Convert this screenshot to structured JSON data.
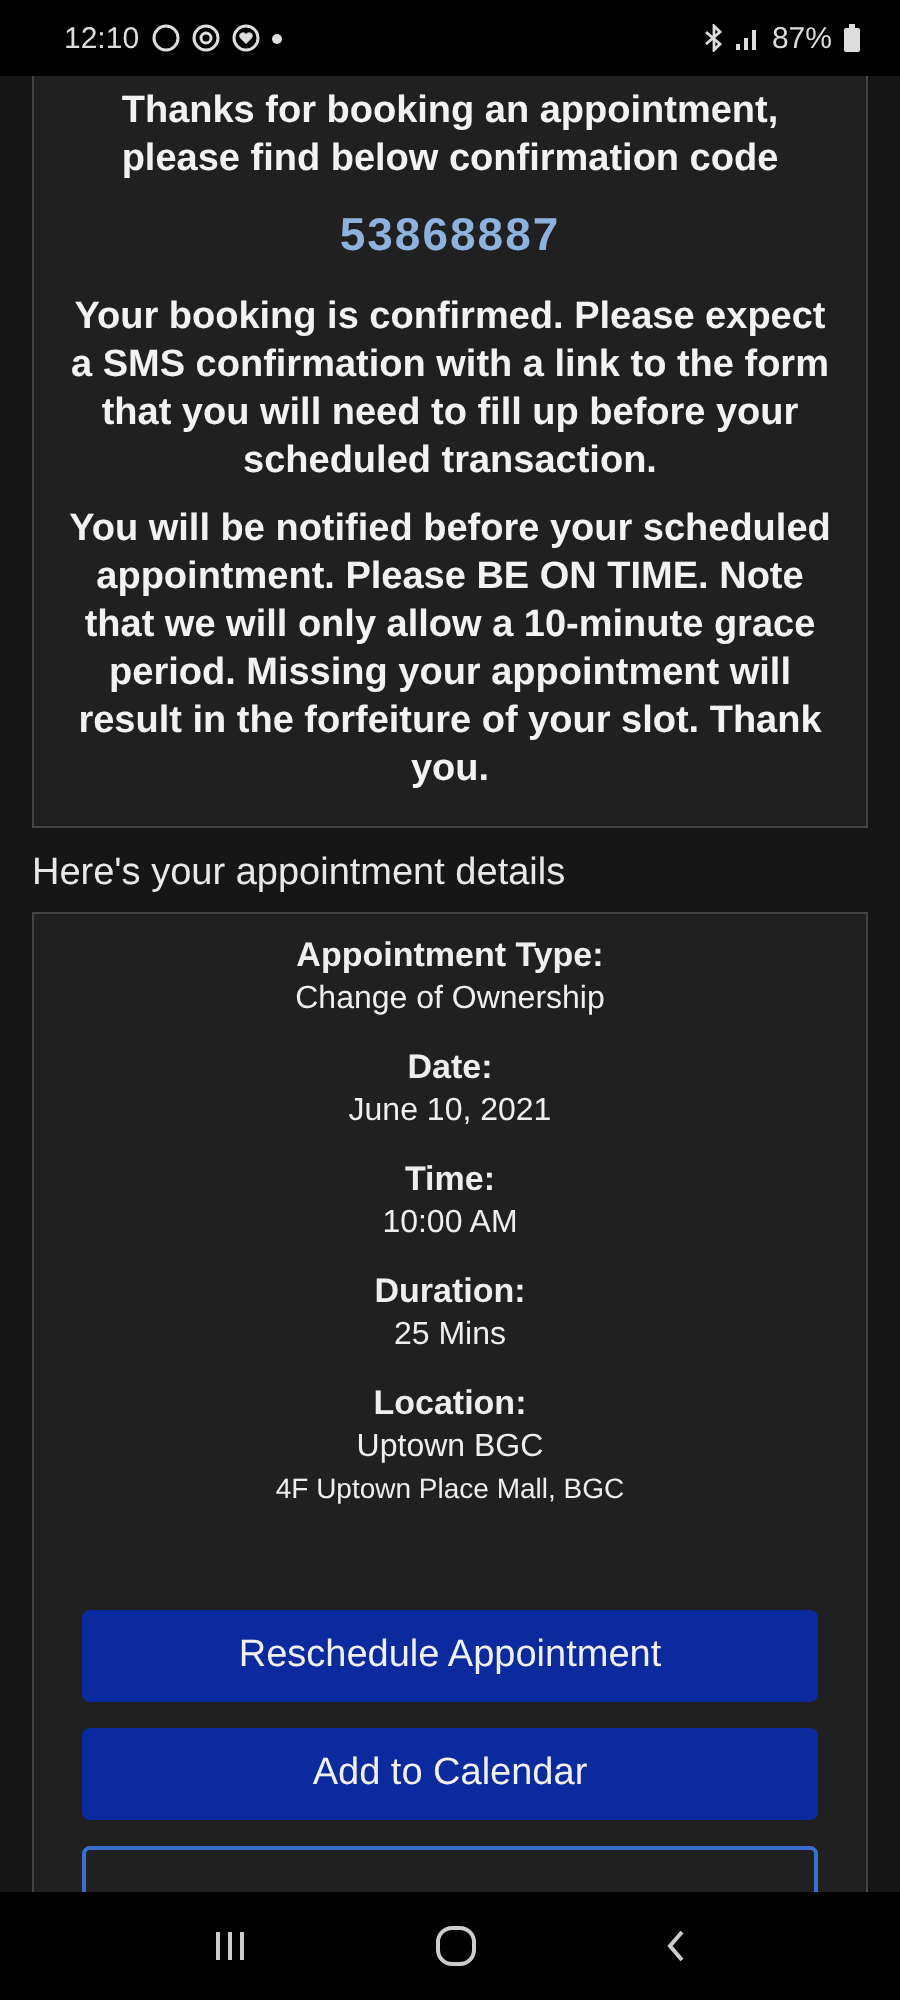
{
  "status_bar": {
    "time": "12:10",
    "battery": "87%"
  },
  "confirmation": {
    "intro": "Thanks for booking an appointment, please find below confirmation code",
    "code": "53868887",
    "paragraphs": [
      "Your booking is confirmed. Please expect a SMS confirmation with a link to the form that you will need to fill up before your scheduled transaction.",
      "You will be notified before your scheduled appointment. Please BE ON TIME. Note that we will only allow a 10-minute grace period. Missing your appointment will result in the forfeiture of your slot. Thank you."
    ]
  },
  "details_heading": "Here's your appointment details",
  "details": [
    {
      "label": "Appointment Type:",
      "value": "Change of Ownership"
    },
    {
      "label": "Date:",
      "value": "June 10, 2021"
    },
    {
      "label": "Time:",
      "value": "10:00 AM"
    },
    {
      "label": "Duration:",
      "value": "25 Mins"
    },
    {
      "label": "Location:",
      "value": "Uptown BGC",
      "note": "4F Uptown Place Mall, BGC"
    }
  ],
  "buttons": [
    {
      "kind": "filled",
      "label": "Reschedule Appointment"
    },
    {
      "kind": "filled",
      "label": "Add to Calendar"
    },
    {
      "kind": "outlined"
    }
  ]
}
